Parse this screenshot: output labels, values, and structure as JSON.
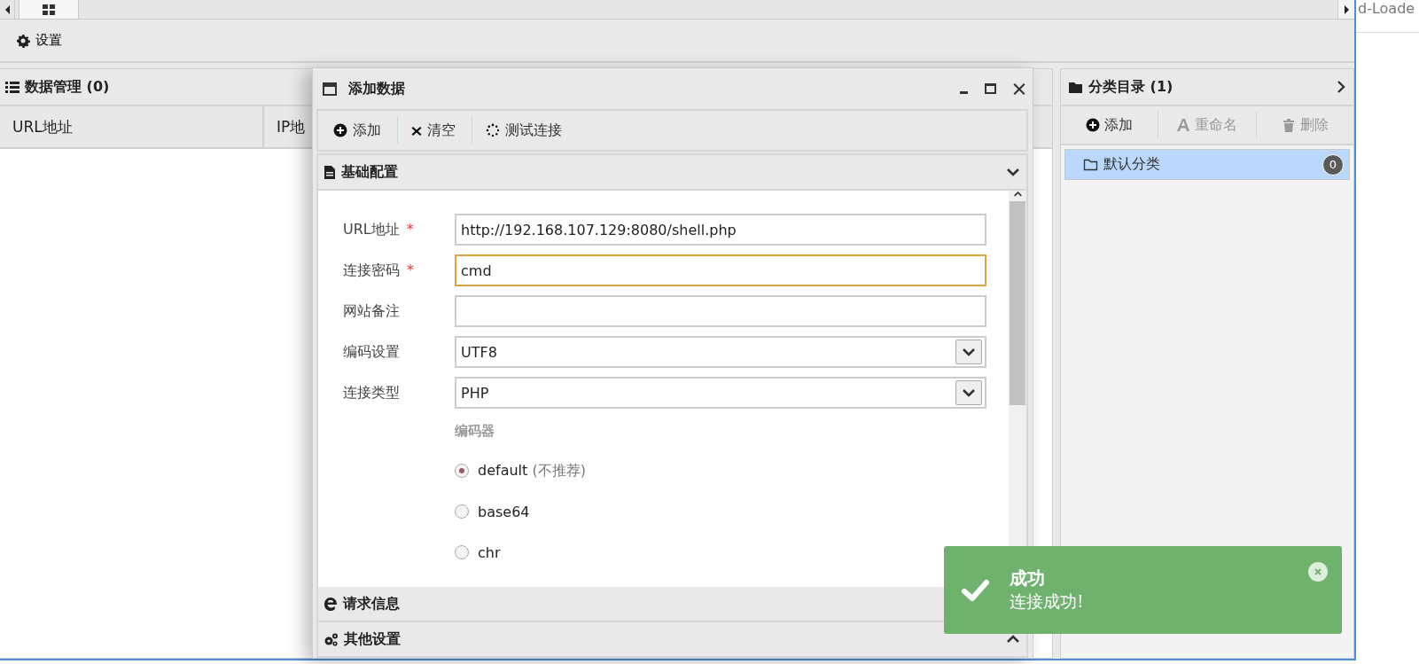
{
  "tab_bar": {
    "tabs": [
      {
        "selected": true
      }
    ]
  },
  "background_window": {
    "text": "d-Loade"
  },
  "toolbar": {
    "items": [
      {
        "label": "设置"
      }
    ]
  },
  "data_panel": {
    "title": "数据管理 (0)",
    "columns": [
      "URL地址",
      "IP地"
    ]
  },
  "dialog": {
    "title": "添加数据",
    "toolbar": [
      {
        "label": "添加"
      },
      {
        "label": "清空"
      },
      {
        "label": "测试连接"
      }
    ],
    "sections": [
      {
        "title": "基础配置",
        "expanded": true
      },
      {
        "title": "请求信息"
      },
      {
        "title": "其他设置",
        "expanded": false
      }
    ],
    "fields": [
      {
        "label": "URL地址",
        "required_mark": "*",
        "kind": "text",
        "value": "http://192.168.107.129:8080/shell.php",
        "focused": false
      },
      {
        "label": "连接密码",
        "required_mark": "*",
        "kind": "text",
        "value": "cmd",
        "focused": true
      },
      {
        "label": "网站备注",
        "kind": "text",
        "focused": false
      },
      {
        "label": "编码设置",
        "kind": "select",
        "value": "UTF8"
      },
      {
        "label": "连接类型",
        "kind": "select",
        "value": "PHP"
      }
    ],
    "encoder": {
      "label": "编码器",
      "options": [
        {
          "label": "default",
          "note": "(不推荐)",
          "selected": true
        },
        {
          "label": "base64",
          "selected": false
        },
        {
          "label": "chr",
          "selected": false
        }
      ]
    }
  },
  "category_panel": {
    "title": "分类目录 (1)",
    "toolbar": [
      {
        "label": "添加",
        "disabled": false
      },
      {
        "label": "重命名",
        "disabled": true
      },
      {
        "label": "删除",
        "disabled": true
      }
    ],
    "items": [
      {
        "label": "默认分类",
        "count": "0",
        "selected": true
      }
    ]
  },
  "toast": {
    "title": "成功",
    "message": "连接成功!"
  }
}
